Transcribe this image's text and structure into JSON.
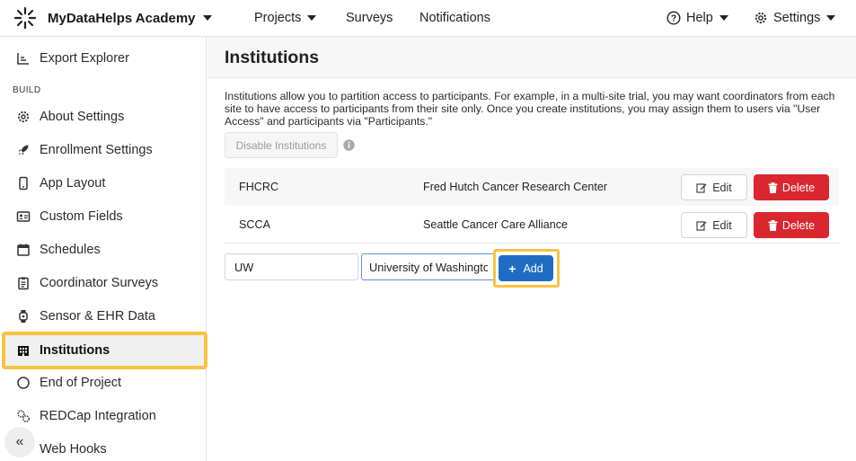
{
  "header": {
    "brand": "MyDataHelps Academy",
    "nav": [
      {
        "label": "Projects",
        "has_dropdown": true
      },
      {
        "label": "Surveys",
        "has_dropdown": false
      },
      {
        "label": "Notifications",
        "has_dropdown": false
      }
    ],
    "help": "Help",
    "settings": "Settings"
  },
  "sidebar": {
    "section_build": "BUILD",
    "items": [
      {
        "label": "Export Explorer",
        "icon": "chart-icon"
      },
      {
        "label": "About Settings",
        "icon": "gear-icon"
      },
      {
        "label": "Enrollment Settings",
        "icon": "rocket-icon"
      },
      {
        "label": "App Layout",
        "icon": "phone-icon"
      },
      {
        "label": "Custom Fields",
        "icon": "id-card-icon"
      },
      {
        "label": "Schedules",
        "icon": "calendar-icon"
      },
      {
        "label": "Coordinator Surveys",
        "icon": "clipboard-icon"
      },
      {
        "label": "Sensor & EHR Data",
        "icon": "watch-icon"
      },
      {
        "label": "Institutions",
        "icon": "building-icon",
        "active": true
      },
      {
        "label": "End of Project",
        "icon": "circle-icon"
      },
      {
        "label": "REDCap Integration",
        "icon": "gears-icon"
      },
      {
        "label": "Web Hooks",
        "icon": "link-icon"
      }
    ],
    "collapse_glyph": "«"
  },
  "main": {
    "title": "Institutions",
    "description": "Institutions allow you to partition access to participants. For example, in a multi-site trial, you may want coordinators from each site to have access to participants from their site only. Once you create institutions, you may assign them to users via \"User Access\" and participants via \"Participants.\"",
    "disable_button": "Disable Institutions",
    "institutions": [
      {
        "code": "FHCRC",
        "name": "Fred Hutch Cancer Research Center"
      },
      {
        "code": "SCCA",
        "name": "Seattle Cancer Care Alliance"
      }
    ],
    "edit_label": "Edit",
    "delete_label": "Delete",
    "new_code_value": "UW",
    "new_name_value": "University of Washington",
    "add_label": "Add"
  },
  "colors": {
    "highlight": "#f6c342",
    "delete": "#d9262f",
    "primary": "#1f6dc2"
  }
}
